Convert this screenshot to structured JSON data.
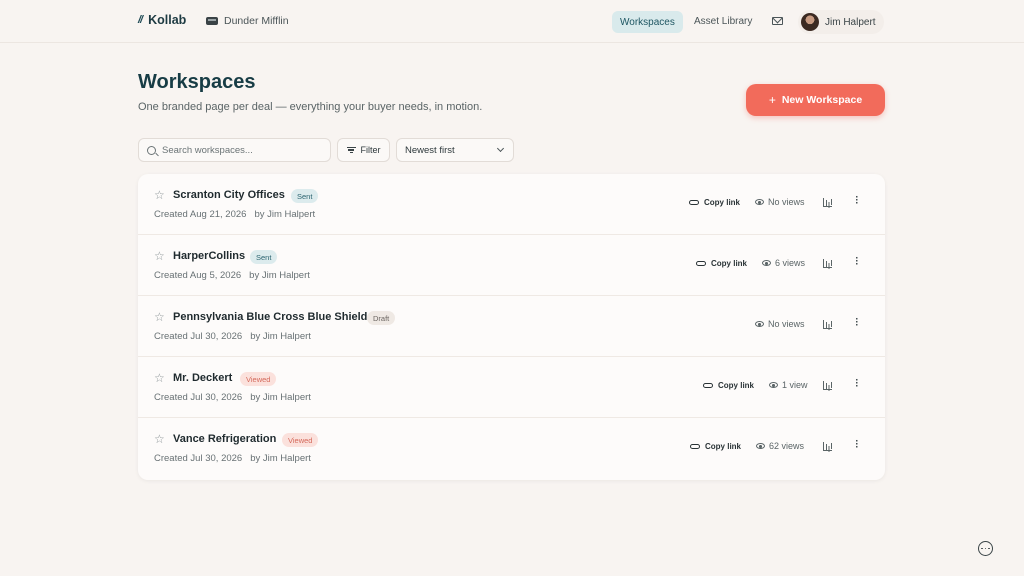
{
  "brand": {
    "mark": "//",
    "name": "Kollab"
  },
  "org": {
    "name": "Dunder Mifflin",
    "icon": "building-icon"
  },
  "nav": {
    "workspaces": "Workspaces",
    "asset_library": "Asset Library",
    "mail_icon": "mail-icon",
    "user_name": "Jim Halpert"
  },
  "header": {
    "title": "Workspaces",
    "subtitle": "One branded page per deal — everything your buyer needs, in motion.",
    "new_button": "New Workspace"
  },
  "toolbar": {
    "search_placeholder": "Search workspaces...",
    "filter_label": "Filter",
    "sort_value": "Newest first"
  },
  "colors": {
    "accent": "#f26b5b",
    "nav_active_bg": "#d9eaec",
    "title": "#173c45"
  },
  "workspaces": [
    {
      "title": "Scranton City Offices",
      "status": "Sent",
      "created": "Created Aug 21, 2026",
      "author": "by Jim Halpert",
      "copy_link": "Copy link",
      "views": "No views"
    },
    {
      "title": "HarperCollins",
      "status": "Sent",
      "created": "Created Aug 5, 2026",
      "author": "by Jim Halpert",
      "copy_link": "Copy link",
      "views": "6 views"
    },
    {
      "title": "Pennsylvania Blue Cross Blue Shield",
      "status": "Draft",
      "created": "Created Jul 30, 2026",
      "author": "by Jim Halpert",
      "copy_link": "",
      "views": "No views"
    },
    {
      "title": "Mr. Deckert",
      "status": "Viewed",
      "created": "Created Jul 30, 2026",
      "author": "by Jim Halpert",
      "copy_link": "Copy link",
      "views": "1 view"
    },
    {
      "title": "Vance Refrigeration",
      "status": "Viewed",
      "created": "Created Jul 30, 2026",
      "author": "by Jim Halpert",
      "copy_link": "Copy link",
      "views": "62 views"
    }
  ]
}
